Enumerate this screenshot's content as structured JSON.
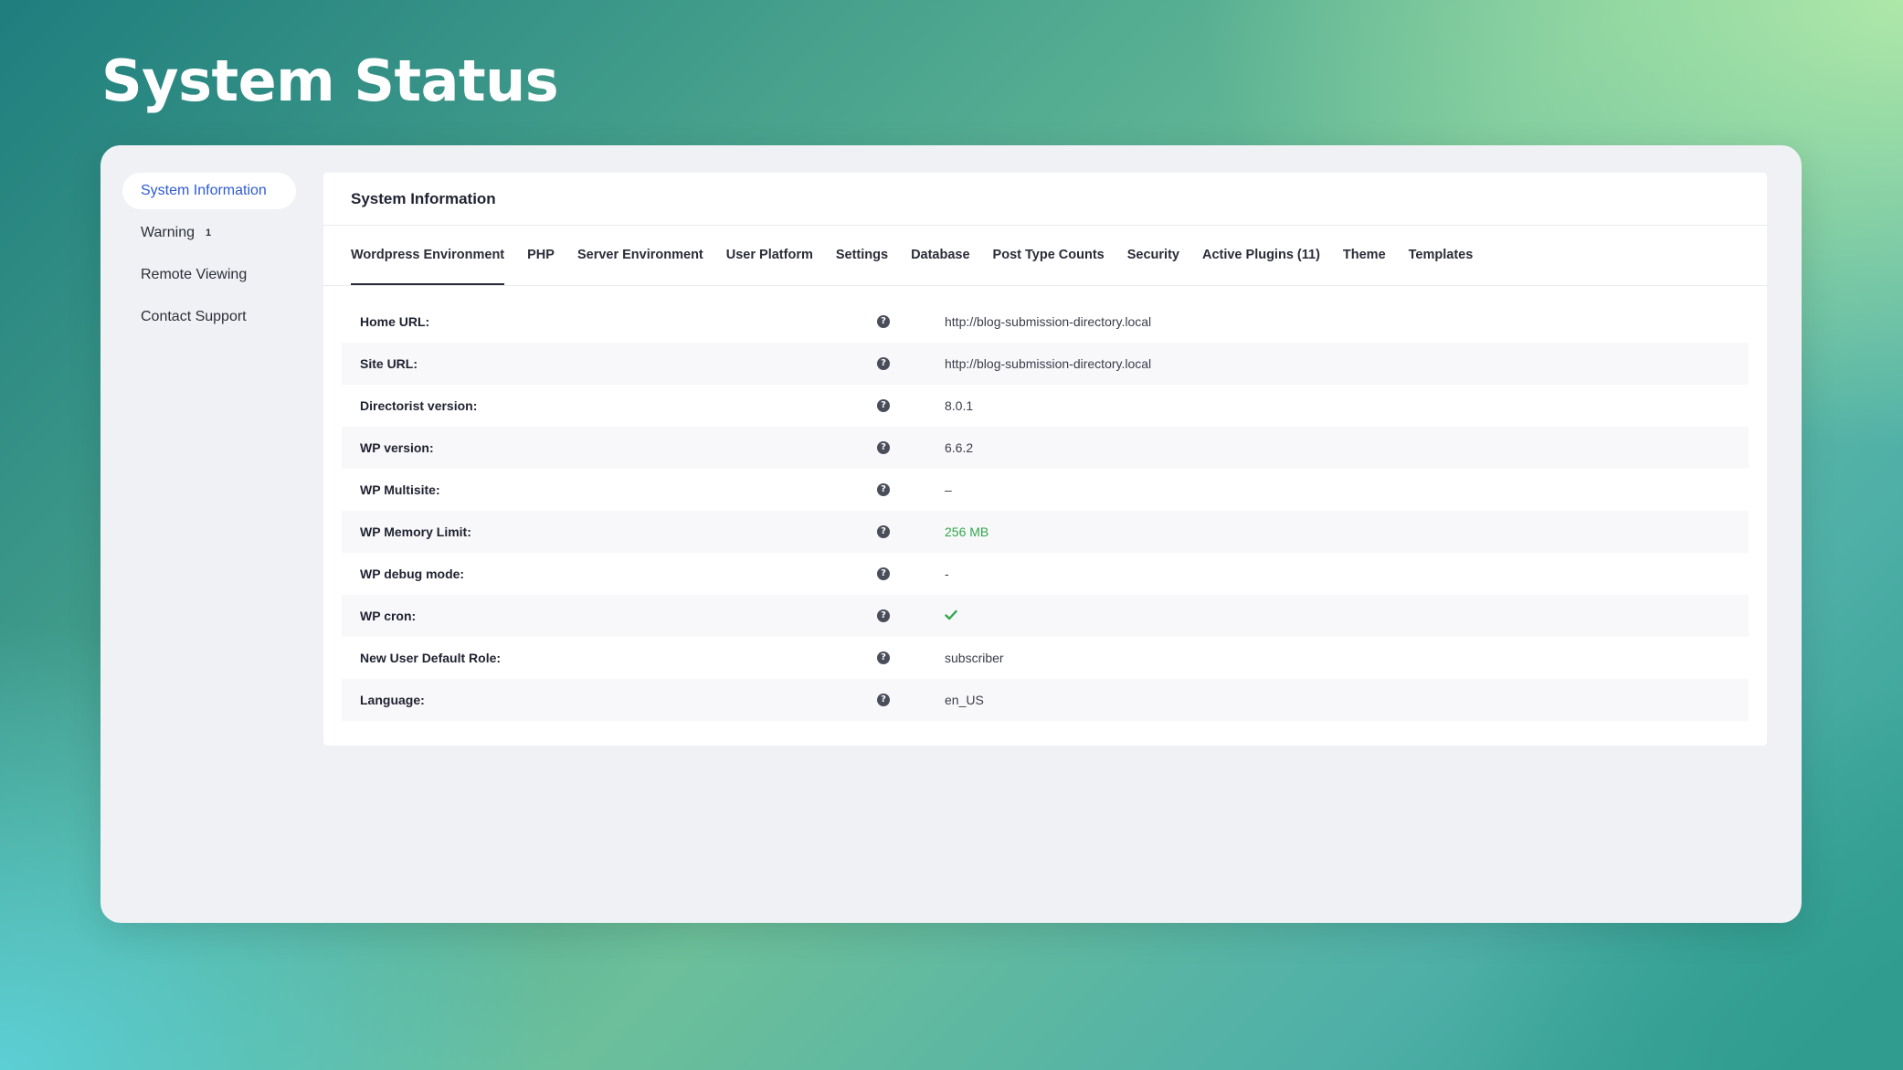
{
  "page_title": "System Status",
  "sidebar": {
    "items": [
      {
        "label": "System Information",
        "badge": ""
      },
      {
        "label": "Warning",
        "badge": "1"
      },
      {
        "label": "Remote Viewing",
        "badge": ""
      },
      {
        "label": "Contact Support",
        "badge": ""
      }
    ]
  },
  "panel": {
    "title": "System Information",
    "tabs": [
      {
        "label": "Wordpress Environment"
      },
      {
        "label": "PHP"
      },
      {
        "label": "Server Environment"
      },
      {
        "label": "User Platform"
      },
      {
        "label": "Settings"
      },
      {
        "label": "Database"
      },
      {
        "label": "Post Type Counts"
      },
      {
        "label": "Security"
      },
      {
        "label": "Active Plugins (11)"
      },
      {
        "label": "Theme"
      },
      {
        "label": "Templates"
      }
    ],
    "help_glyph": "?",
    "rows": [
      {
        "label": "Home URL:",
        "value": "http://blog-submission-directory.local"
      },
      {
        "label": "Site URL:",
        "value": "http://blog-submission-directory.local"
      },
      {
        "label": "Directorist version:",
        "value": "8.0.1"
      },
      {
        "label": "WP version:",
        "value": "6.6.2"
      },
      {
        "label": "WP Multisite:",
        "value": "–"
      },
      {
        "label": "WP Memory Limit:",
        "value": "256 MB"
      },
      {
        "label": "WP debug mode:",
        "value": "-"
      },
      {
        "label": "WP cron:",
        "value": ""
      },
      {
        "label": "New User Default Role:",
        "value": "subscriber"
      },
      {
        "label": "Language:",
        "value": "en_US"
      }
    ]
  },
  "colors": {
    "active_link": "#2f5bd3",
    "success": "#2fa84a"
  }
}
